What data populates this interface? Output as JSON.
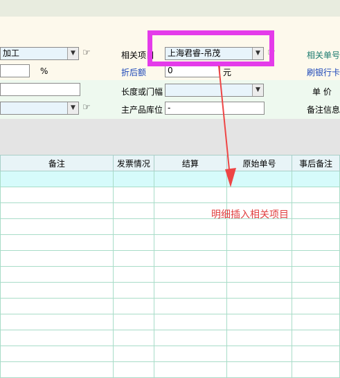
{
  "form": {
    "row1": {
      "left_combo_value": "加工",
      "related_project_label": "相关项目",
      "related_project_value": "上海君睿-吊茂",
      "related_order_label": "相关单号"
    },
    "row2": {
      "percent_value": "",
      "percent_unit": "%",
      "discount_label": "折后额",
      "discount_value": "0",
      "discount_unit": "元",
      "bank_card_label": "刷银行卡"
    },
    "row3": {
      "left_text_value": "",
      "length_label": "长度或门幅",
      "length_value": "",
      "unit_price_label": "单 价"
    },
    "row4": {
      "left_combo_value": "",
      "main_location_label": "主产品库位",
      "main_location_value": "-",
      "remarks_label": "备注信息"
    }
  },
  "grid": {
    "columns": [
      "备注",
      "发票情况",
      "结算",
      "原始单号",
      "事后备注"
    ],
    "row_count": 13
  },
  "annotation": {
    "text": "明细插入相关项目",
    "color": "#e04040",
    "highlight_color": "#e43bea"
  },
  "icons": {
    "hand": "☞",
    "dropdown": "▼"
  }
}
